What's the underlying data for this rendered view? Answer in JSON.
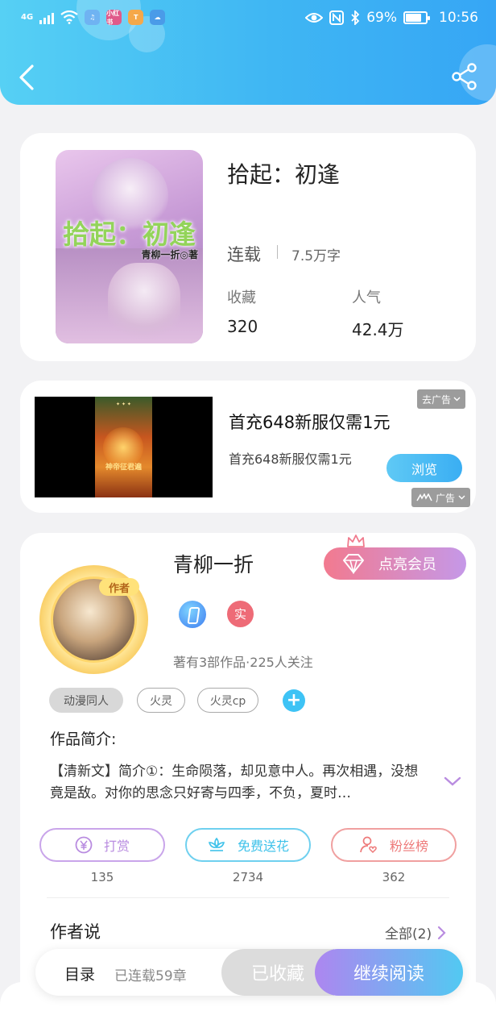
{
  "status_bar": {
    "network": "4G",
    "app_icons": [
      {
        "name": "music-app-icon",
        "color": "#6fb3f2",
        "text": ""
      },
      {
        "name": "xiaohongshu-app-icon",
        "color": "#e05a8a",
        "text": "小红书"
      },
      {
        "name": "calendar-app-icon",
        "color": "#f5a84a",
        "text": ""
      },
      {
        "name": "weather-app-icon",
        "color": "#4a9be8",
        "text": ""
      }
    ],
    "battery": "69%",
    "time": "10:56"
  },
  "book": {
    "cover_title": "拾起：初逢",
    "cover_author": "青柳一折◎著",
    "title": "拾起：初逢",
    "status": "连载",
    "word_count": "7.5万字",
    "favorites_label": "收藏",
    "favorites_value": "320",
    "popularity_label": "人气",
    "popularity_value": "42.4万"
  },
  "ad": {
    "goto_label": "去广告",
    "title": "首充648新服仅需1元",
    "description": "首充648新服仅需1元",
    "browse_label": "浏览",
    "ad_label": "广告",
    "image_caption": "神帝征君遍"
  },
  "author": {
    "badge": "作者",
    "name": "青柳一折",
    "vip_label": "点亮会员",
    "real_badge": "实",
    "meta": "著有3部作品·225人关注",
    "tags": [
      "动漫同人",
      "火灵",
      "火灵cp"
    ],
    "intro_label": "作品简介:",
    "intro_text": "【清新文】简介①：生命陨落，却见意中人。再次相遇，没想竟是敌。对你的思念只好寄与四季，不负，夏时…",
    "actions": [
      {
        "label": "打赏",
        "count": "135",
        "color": "#b98ce0"
      },
      {
        "label": "免费送花",
        "count": "2734",
        "color": "#3fc2ea"
      },
      {
        "label": "粉丝榜",
        "count": "362",
        "color": "#ee7a7a"
      }
    ],
    "author_say": "作者说",
    "all_link": "全部(2)"
  },
  "bottom_bar": {
    "toc": "目录",
    "chapters": "已连载59章",
    "collected": "已收藏",
    "continue": "继续阅读"
  }
}
